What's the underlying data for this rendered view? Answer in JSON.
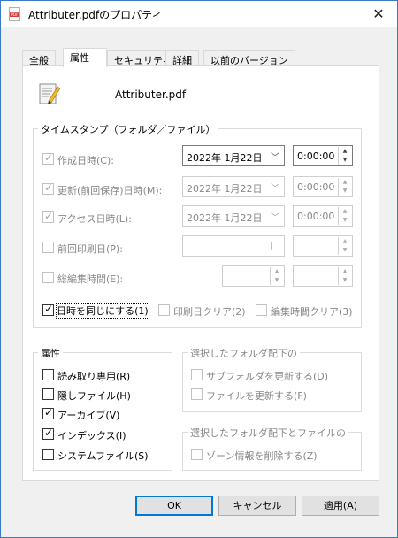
{
  "window": {
    "title": "Attributer.pdfのプロパティ",
    "close": "✕"
  },
  "tabs": [
    "全般",
    "属性",
    "セキュリティ",
    "詳細",
    "以前のバージョン"
  ],
  "file": {
    "name": "Attributer.pdf"
  },
  "timestamp": {
    "label": "タイムスタンプ（フォルダ／ファイル）",
    "rows": [
      {
        "label": "作成日時(C):",
        "checked": true,
        "date": "2022年  1月22日",
        "time": "0:00:00"
      },
      {
        "label": "更新(前回保存)日時(M):",
        "checked": true,
        "date": "2022年  1月22日",
        "time": "0:00:00"
      },
      {
        "label": "アクセス日時(L):",
        "checked": true,
        "date": "2022年  1月22日",
        "time": "0:00:00"
      },
      {
        "label": "前回印刷日(P):",
        "checked": false,
        "date": "",
        "time": ""
      },
      {
        "label": "総編集時間(E):",
        "checked": false,
        "date": "",
        "time": ""
      }
    ],
    "same_time": {
      "label": "日時を同じにする(1)",
      "checked": true
    },
    "print_clear": {
      "label": "印刷日クリア(2)",
      "checked": false
    },
    "edit_clear": {
      "label": "編集時間クリア(3)",
      "checked": false
    }
  },
  "attributes": {
    "label": "属性",
    "items": [
      {
        "label": "読み取り専用(R)",
        "checked": false
      },
      {
        "label": "隠しファイル(H)",
        "checked": false
      },
      {
        "label": "アーカイブ(V)",
        "checked": true
      },
      {
        "label": "インデックス(I)",
        "checked": true
      },
      {
        "label": "システムファイル(S)",
        "checked": false
      }
    ]
  },
  "folder_group": {
    "label": "選択したフォルダ配下の",
    "items": [
      {
        "label": "サブフォルダを更新する(D)",
        "checked": false
      },
      {
        "label": "ファイルを更新する(F)",
        "checked": false
      }
    ]
  },
  "folder_file_group": {
    "label": "選択したフォルダ配下とファイルの",
    "items": [
      {
        "label": "ゾーン情報を削除する(Z)",
        "checked": false
      }
    ]
  },
  "buttons": {
    "ok": "OK",
    "cancel": "キャンセル",
    "apply": "適用(A)"
  },
  "colors": {
    "accent": "#0078d7",
    "pdf_icon": "#d83b3b"
  }
}
